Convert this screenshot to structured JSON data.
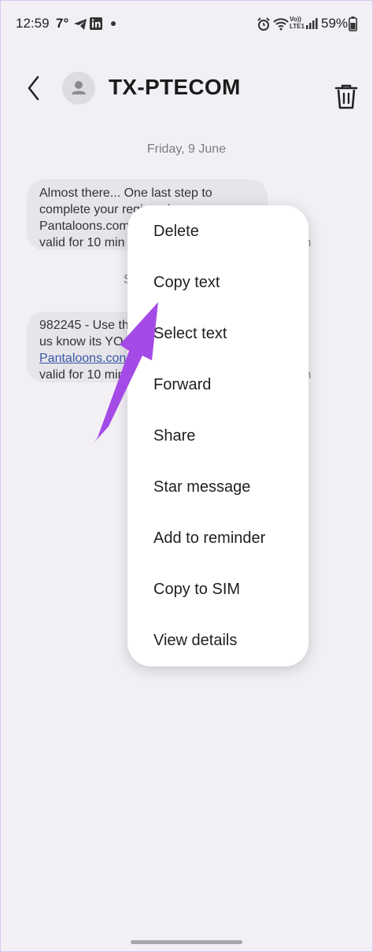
{
  "status_bar": {
    "time": "12:59",
    "temperature": "7°",
    "icons_left": [
      "telegram-icon",
      "linkedin-icon",
      "dot-icon"
    ],
    "icons_right": [
      "alarm-icon",
      "wifi-icon",
      "volte-icon",
      "signal-icon",
      "battery-icon"
    ],
    "network_label": "Vo)) LTE1",
    "battery": "59%"
  },
  "header": {
    "contact_name": "TX-PTECOM"
  },
  "conversation": {
    "date_separator": "Friday, 9 June",
    "date_separator_partial": "S",
    "messages": [
      {
        "lines": [
          "Almost there... One last step to",
          "complete your registratio",
          "Pantaloons.com",
          "valid for 10 min"
        ],
        "time_partial": "n"
      },
      {
        "lines": [
          "982245 - Use th",
          "us know its YO",
          "Pantaloons.con",
          "valid for 10 min"
        ],
        "link_line": "Pantaloons.con",
        "time_partial": "n"
      }
    ]
  },
  "context_menu": {
    "items": [
      "Delete",
      "Copy text",
      "Select text",
      "Forward",
      "Share",
      "Star message",
      "Add to reminder",
      "Copy to SIM",
      "View details"
    ]
  },
  "colors": {
    "background": "#f2f0f5",
    "bubble": "#e6e5ea",
    "menu": "#ffffff",
    "annotation_arrow": "#a44ae6",
    "link": "#3a57a6"
  }
}
